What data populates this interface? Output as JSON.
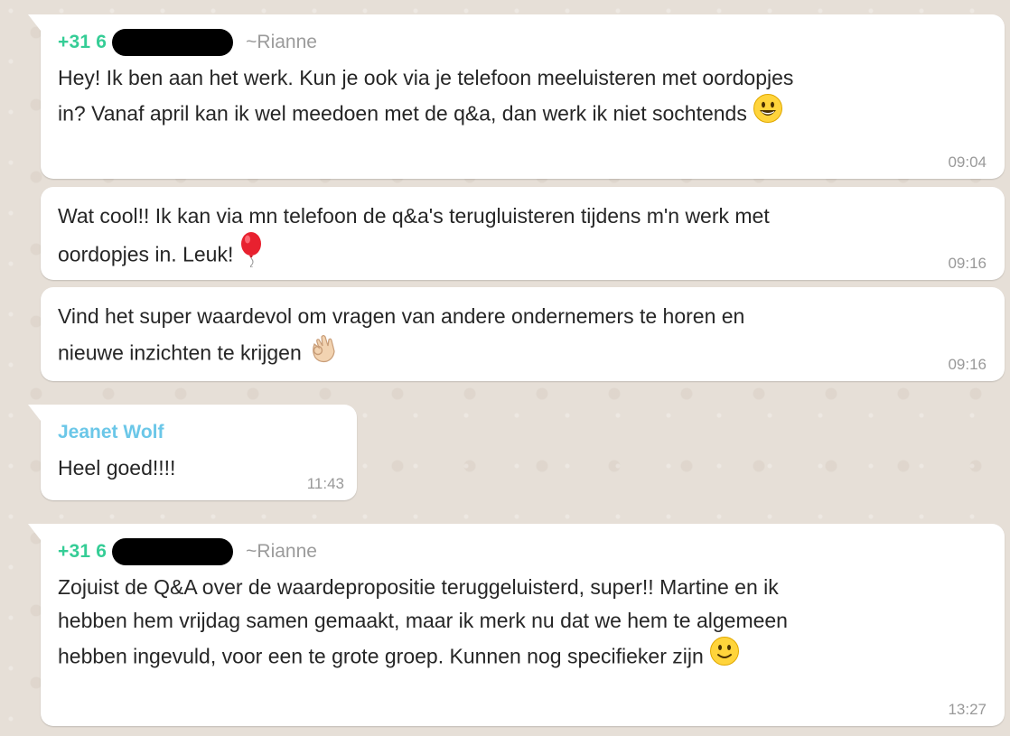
{
  "messages": [
    {
      "phone": "+31 6",
      "nickname": "~Rianne",
      "text_line1": "Hey! Ik ben aan het werk. Kun je ook via je telefoon meeluisteren met oordopjes",
      "text_line2": "in? Vanaf april kan ik wel meedoen met de q&a, dan werk ik niet sochtends",
      "emoji": "smiley-emoji",
      "time": "09:04"
    },
    {
      "text_line1": "Wat cool!! Ik kan via mn telefoon de q&a's terugluisteren tijdens m'n werk met",
      "text_line2": "oordopjes in. Leuk!",
      "emoji": "balloon-emoji",
      "time": "09:16"
    },
    {
      "text_line1": "Vind het super waardevol om vragen van andere ondernemers te horen en",
      "text_line2": "nieuwe inzichten te krijgen",
      "emoji": "ok-hand-emoji",
      "time": "09:16"
    },
    {
      "sender": "Jeanet Wolf",
      "text_line1": "Heel goed!!!!",
      "time": "11:43"
    },
    {
      "phone": "+31 6",
      "nickname": "~Rianne",
      "text_line1": "Zojuist de Q&A over de waardepropositie teruggeluisterd, super!! Martine en ik",
      "text_line2": "hebben hem vrijdag samen gemaakt, maar ik merk nu dat we hem te algemeen",
      "text_line3": "hebben ingevuld, voor een te grote groep. Kunnen nog specifieker zijn",
      "emoji": "slightly-smiling-emoji",
      "time": "13:27"
    }
  ],
  "colors": {
    "background": "#e6dfd7",
    "bubble": "#ffffff",
    "phone_sender": "#35cd96",
    "named_sender": "#6bc7e8",
    "text": "#262626",
    "meta": "#999999"
  }
}
